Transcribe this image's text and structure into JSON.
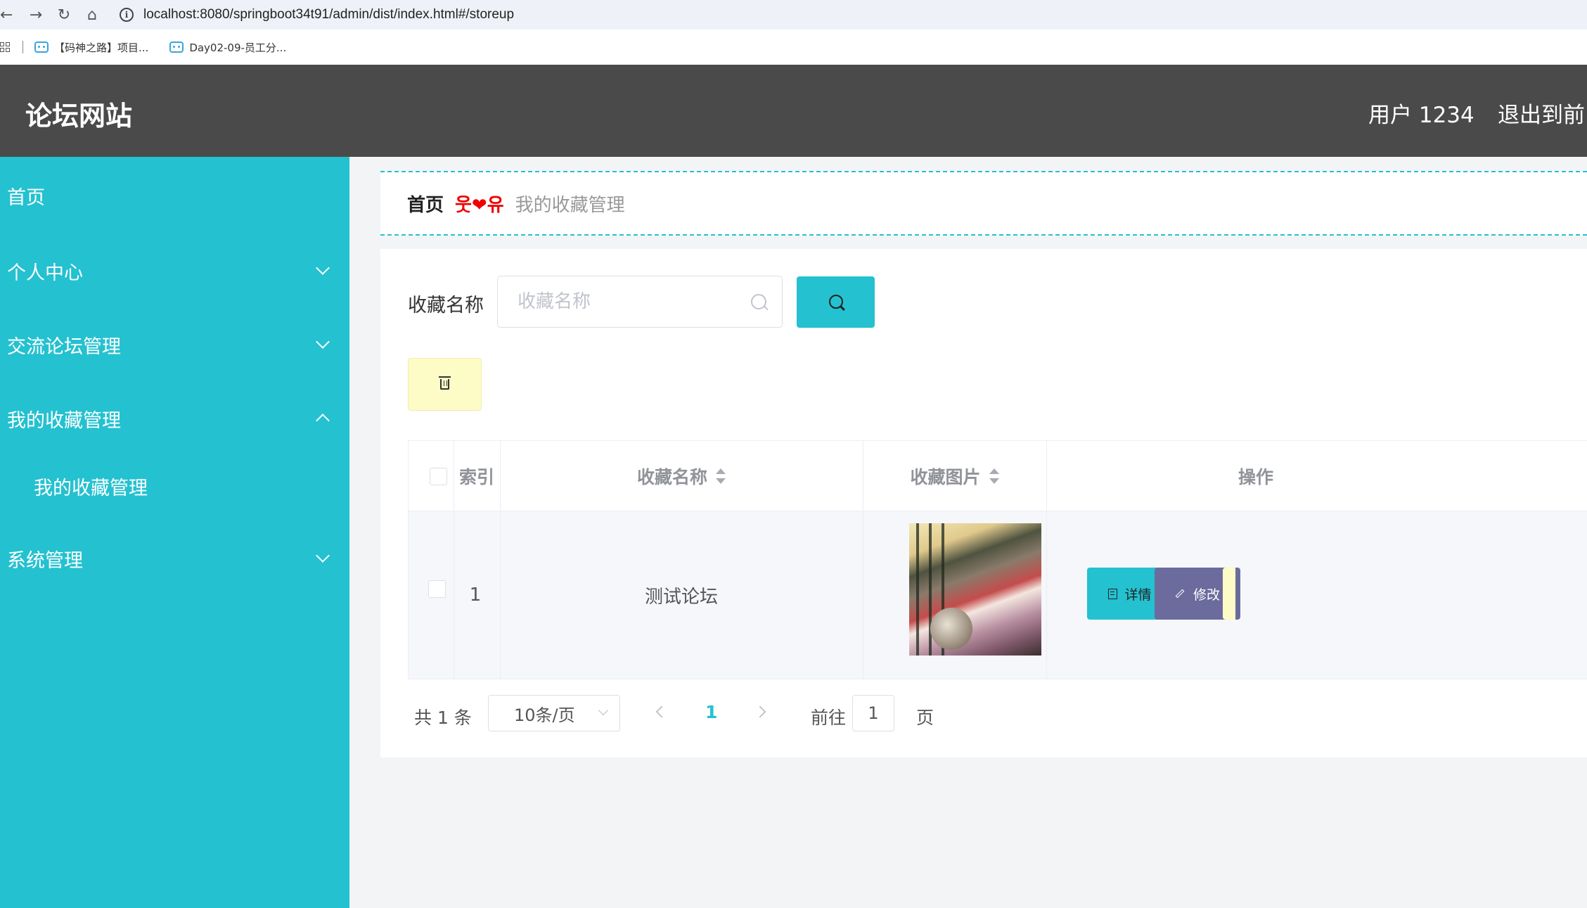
{
  "browser": {
    "url": "localhost:8080/springboot34t91/admin/dist/index.html#/storeup",
    "bookmarks": [
      "【码神之路】项目...",
      "Day02-09-员工分..."
    ]
  },
  "header": {
    "title": "论坛网站",
    "user": "用户 1234",
    "exit": "退出到前台"
  },
  "sidebar": {
    "items": [
      {
        "label": "首页"
      },
      {
        "label": "个人中心"
      },
      {
        "label": "交流论坛管理"
      },
      {
        "label": "我的收藏管理"
      },
      {
        "label": "我的收藏管理"
      },
      {
        "label": "系统管理"
      }
    ]
  },
  "breadcrumb": {
    "home": "首页",
    "separator": "웃❤유",
    "current": "我的收藏管理"
  },
  "search": {
    "label": "收藏名称",
    "placeholder": "收藏名称",
    "value": ""
  },
  "table": {
    "headers": {
      "index": "索引",
      "name": "收藏名称",
      "image": "收藏图片",
      "actions": "操作"
    },
    "rows": [
      {
        "index": "1",
        "name": "测试论坛"
      }
    ],
    "detail_label": "详情",
    "edit_label": "修改"
  },
  "pagination": {
    "total": "共 1 条",
    "page_size": "10条/页",
    "current_page": "1",
    "goto_label": "前往",
    "goto_value": "1",
    "page_unit": "页"
  },
  "colors": {
    "accent": "#24c1d0",
    "header_bg": "#4a4a4a",
    "edit_button": "#6b6b9e",
    "delete_button": "#fdfcc6"
  }
}
